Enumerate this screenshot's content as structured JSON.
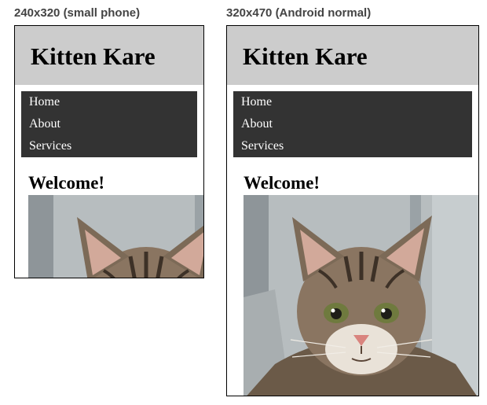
{
  "devices": [
    {
      "caption": "240x320 (small phone)",
      "title": "Kitten Kare",
      "nav": [
        "Home",
        "About",
        "Services"
      ],
      "heading": "Welcome!"
    },
    {
      "caption": "320x470 (Android normal)",
      "title": "Kitten Kare",
      "nav": [
        "Home",
        "About",
        "Services"
      ],
      "heading": "Welcome!"
    }
  ],
  "icons": {
    "photo": "kitten-photo"
  }
}
